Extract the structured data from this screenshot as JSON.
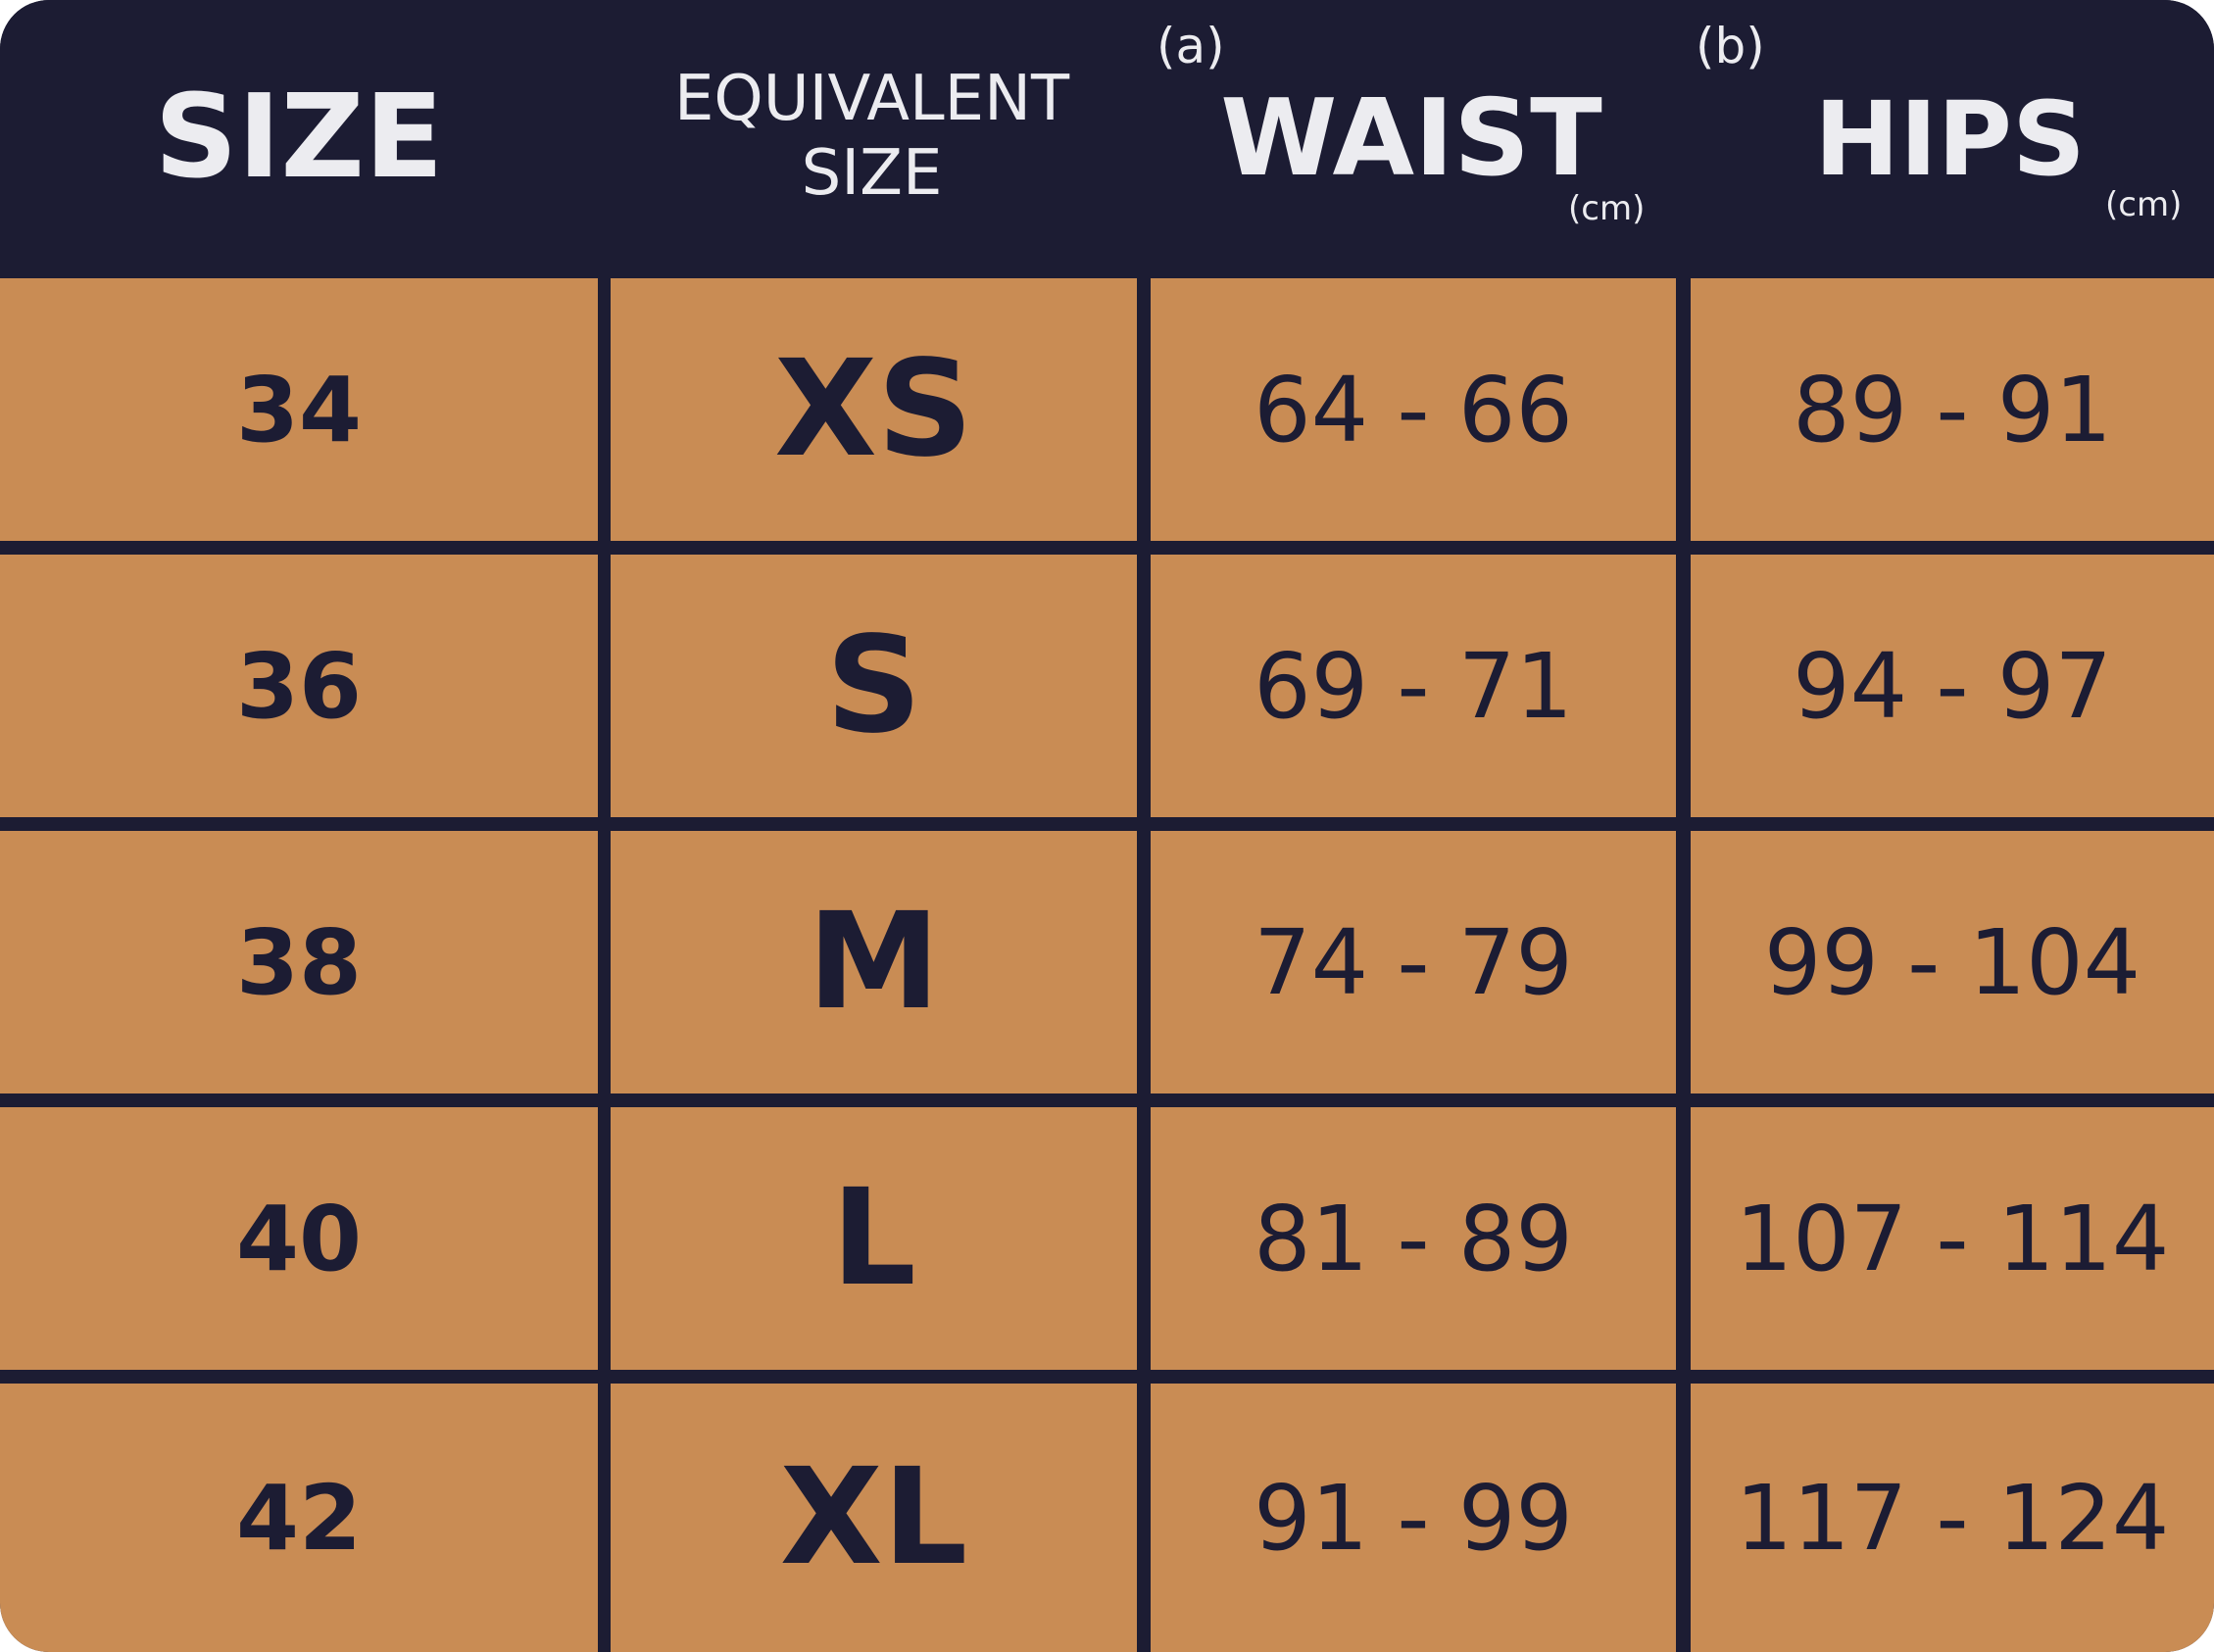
{
  "header": {
    "size": "SIZE",
    "equivalent_line1": "EQUIVALENT",
    "equivalent_line2": "SIZE",
    "waist": "WAIST",
    "waist_note": "(a)",
    "waist_unit": "(cm)",
    "hips": "HIPS",
    "hips_note": "(b)",
    "hips_unit": "(cm)"
  },
  "rows": [
    {
      "size": "34",
      "equivalent": "XS",
      "waist": "64 - 66",
      "hips": "89 - 91"
    },
    {
      "size": "36",
      "equivalent": "S",
      "waist": "69 - 71",
      "hips": "94 - 97"
    },
    {
      "size": "38",
      "equivalent": "M",
      "waist": "74 - 79",
      "hips": "99 - 104"
    },
    {
      "size": "40",
      "equivalent": "L",
      "waist": "81 - 89",
      "hips": "107 - 114"
    },
    {
      "size": "42",
      "equivalent": "XL",
      "waist": "91 - 99",
      "hips": "117 - 124"
    }
  ],
  "colors": {
    "header_bg": "#1c1c33",
    "header_text": "#ececf0",
    "cell_bg": "#c98c54",
    "cell_text": "#1c1c33",
    "grid_lines": "#1c1c33"
  }
}
